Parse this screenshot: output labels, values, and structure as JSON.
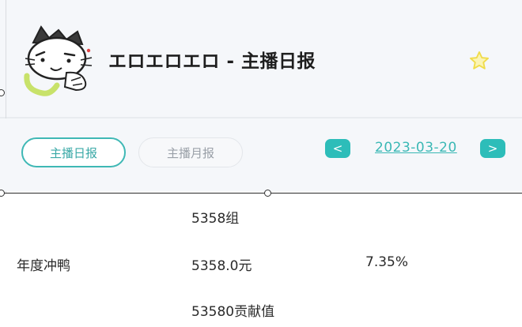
{
  "header": {
    "title": "エロエロエロ - 主播日报"
  },
  "icons": {
    "avatar": "cartoon-cat-avatar-icon",
    "favorite": "star-icon",
    "prev": "chevron-left-icon",
    "next": "chevron-right-icon"
  },
  "tabs": [
    {
      "label": "主播日报",
      "active": true
    },
    {
      "label": "主播月报",
      "active": false
    }
  ],
  "date_nav": {
    "prev_label": "<",
    "date": "2023-03-20",
    "next_label": ">"
  },
  "report": {
    "row_label": "年度冲鸭",
    "groups": "5358组",
    "amount": "5358.0元",
    "percent": "7.35%",
    "contribution": "53580贡献值"
  },
  "colors": {
    "accent": "#2dbdb9",
    "star": "#f5e96a",
    "header_bg": "#f5f7fa"
  }
}
